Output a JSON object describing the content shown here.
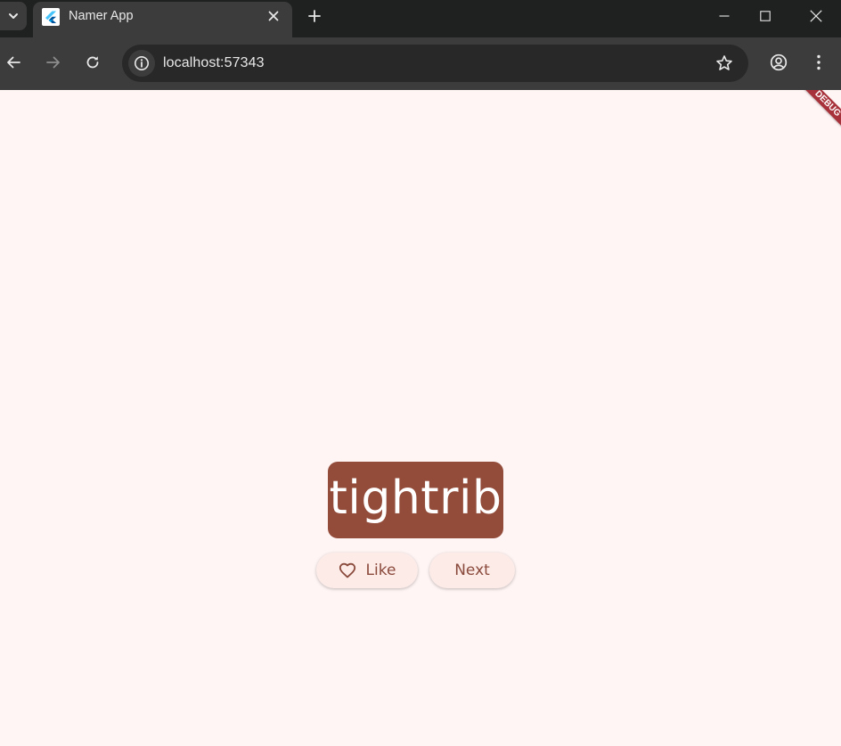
{
  "browser": {
    "tab": {
      "title": "Namer App",
      "favicon": "flutter-logo-icon"
    },
    "omnibox": {
      "url": "localhost:57343"
    },
    "icons": {
      "tab_search": "chevron-down-icon",
      "tab_close": "close-icon",
      "new_tab": "plus-icon",
      "minimize": "minimize-icon",
      "maximize": "maximize-icon",
      "window_close": "close-icon",
      "back": "back-arrow-icon",
      "forward": "forward-arrow-icon",
      "reload": "reload-icon",
      "site_info": "info-icon",
      "bookmark": "star-icon",
      "profile": "profile-icon",
      "menu": "more-vert-icon"
    },
    "colors": {
      "tabstrip": "#1f2020",
      "toolbar": "#3c3c3c",
      "omnibox": "#282828"
    }
  },
  "app": {
    "debug_banner": "DEBUG",
    "word": "tightrib",
    "like_label": "Like",
    "next_label": "Next",
    "colors": {
      "background": "#fff5f4",
      "card": "#934b3a",
      "button_bg": "#fdebe8",
      "button_text": "#8a4a3c",
      "debug_banner": "#a8323b"
    }
  }
}
